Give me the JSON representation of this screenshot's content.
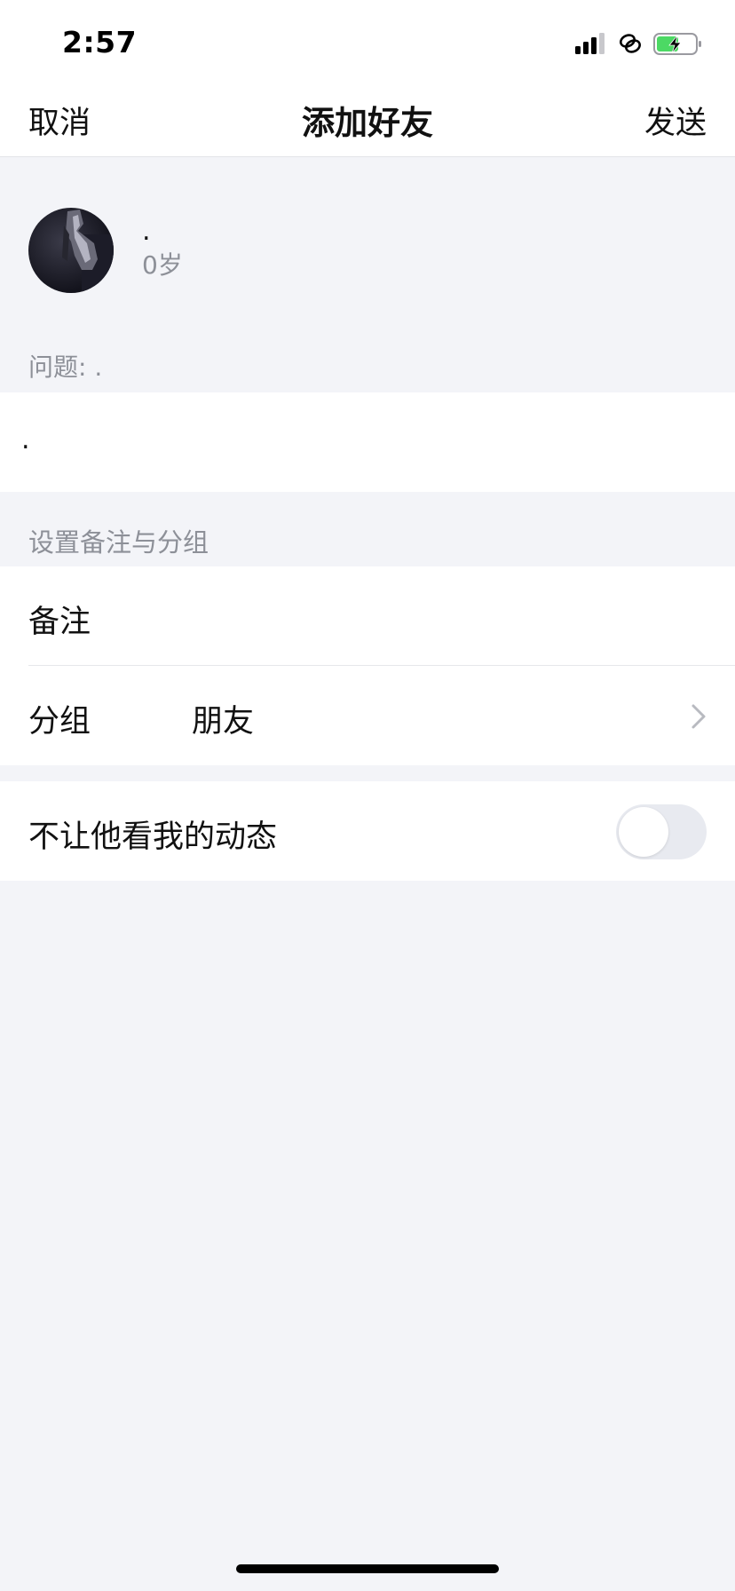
{
  "status_bar": {
    "time": "2:57",
    "icons": [
      "signal-icon",
      "link-icon",
      "battery-charging-icon"
    ],
    "battery_color": "#4cd964"
  },
  "nav": {
    "cancel_label": "取消",
    "title": "添加好友",
    "send_label": "发送"
  },
  "profile": {
    "name": ".",
    "age": "0岁"
  },
  "question": {
    "label": "问题: .",
    "answer": "."
  },
  "settings": {
    "section_header": "设置备注与分组",
    "remark_label": "备注",
    "group_label": "分组",
    "group_value": "朋友",
    "chevron_icon": "chevron-right-icon"
  },
  "privacy": {
    "label": "不让他看我的动态",
    "toggle_on": false
  }
}
